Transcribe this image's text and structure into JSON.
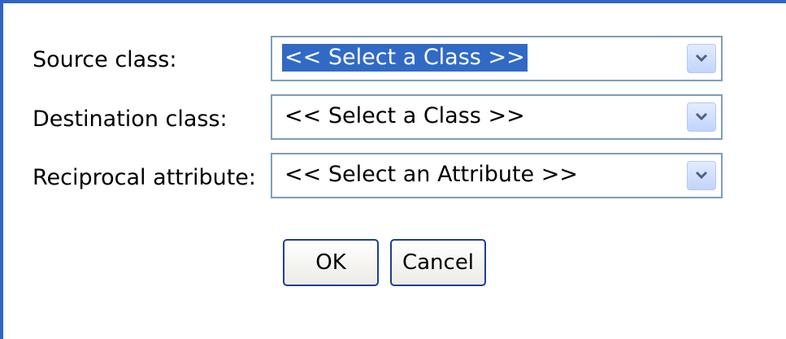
{
  "form": {
    "rows": [
      {
        "label": "Source class:",
        "value": "<< Select a Class >>"
      },
      {
        "label": "Destination class:",
        "value": "<< Select a Class >>"
      },
      {
        "label": "Reciprocal attribute:",
        "value": "<< Select an Attribute >>"
      }
    ]
  },
  "buttons": {
    "ok": "OK",
    "cancel": "Cancel"
  },
  "colors": {
    "frame": "#2f63c5",
    "selection": "#316ac5",
    "field_border": "#7f9db9",
    "button_border": "#1c3f8f"
  },
  "icons": {
    "dropdown": "chevron-down-icon"
  }
}
